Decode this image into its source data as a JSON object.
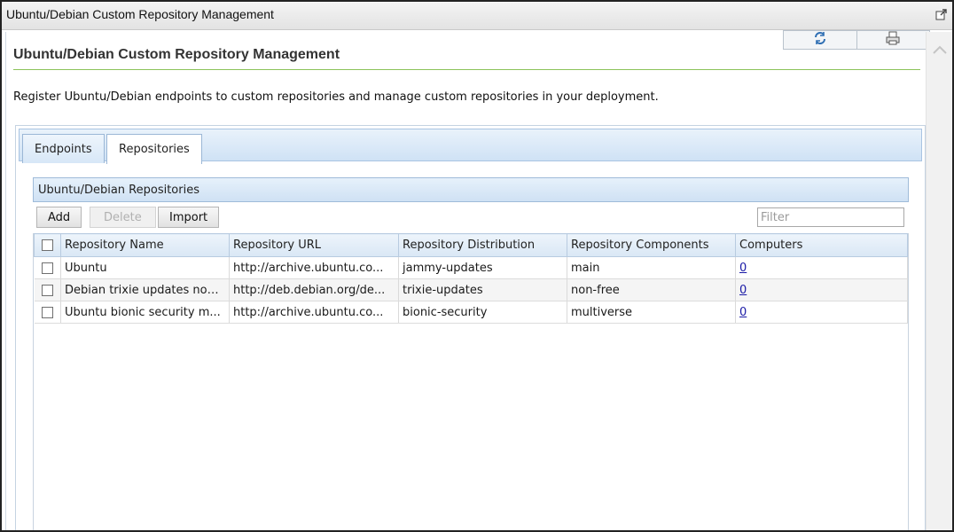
{
  "window": {
    "title": "Ubuntu/Debian Custom Repository Management"
  },
  "page": {
    "title": "Ubuntu/Debian Custom Repository Management",
    "description": "Register Ubuntu/Debian endpoints to custom repositories and manage custom repositories in your deployment."
  },
  "toolbar_icons": [
    "refresh-icon",
    "print-icon"
  ],
  "tabs": [
    {
      "label": "Endpoints",
      "active": false
    },
    {
      "label": "Repositories",
      "active": true
    }
  ],
  "grid": {
    "title": "Ubuntu/Debian Repositories",
    "buttons": {
      "add": "Add",
      "delete": "Delete",
      "import": "Import"
    },
    "filter_placeholder": "Filter",
    "columns": [
      "Repository Name",
      "Repository URL",
      "Repository Distribution",
      "Repository Components",
      "Computers"
    ],
    "rows": [
      {
        "name": "Ubuntu",
        "url": "http://archive.ubuntu.co...",
        "distribution": "jammy-updates",
        "components": "main",
        "computers": "0"
      },
      {
        "name": "Debian trixie updates non...",
        "url": "http://deb.debian.org/de...",
        "distribution": "trixie-updates",
        "components": "non-free",
        "computers": "0"
      },
      {
        "name": "Ubuntu bionic security m...",
        "url": "http://archive.ubuntu.co...",
        "distribution": "bionic-security",
        "components": "multiverse",
        "computers": "0"
      }
    ]
  },
  "colors": {
    "accent_rule": "#8cc35a",
    "header_blue": "#cfe1f4",
    "link": "#1a1aa6"
  }
}
